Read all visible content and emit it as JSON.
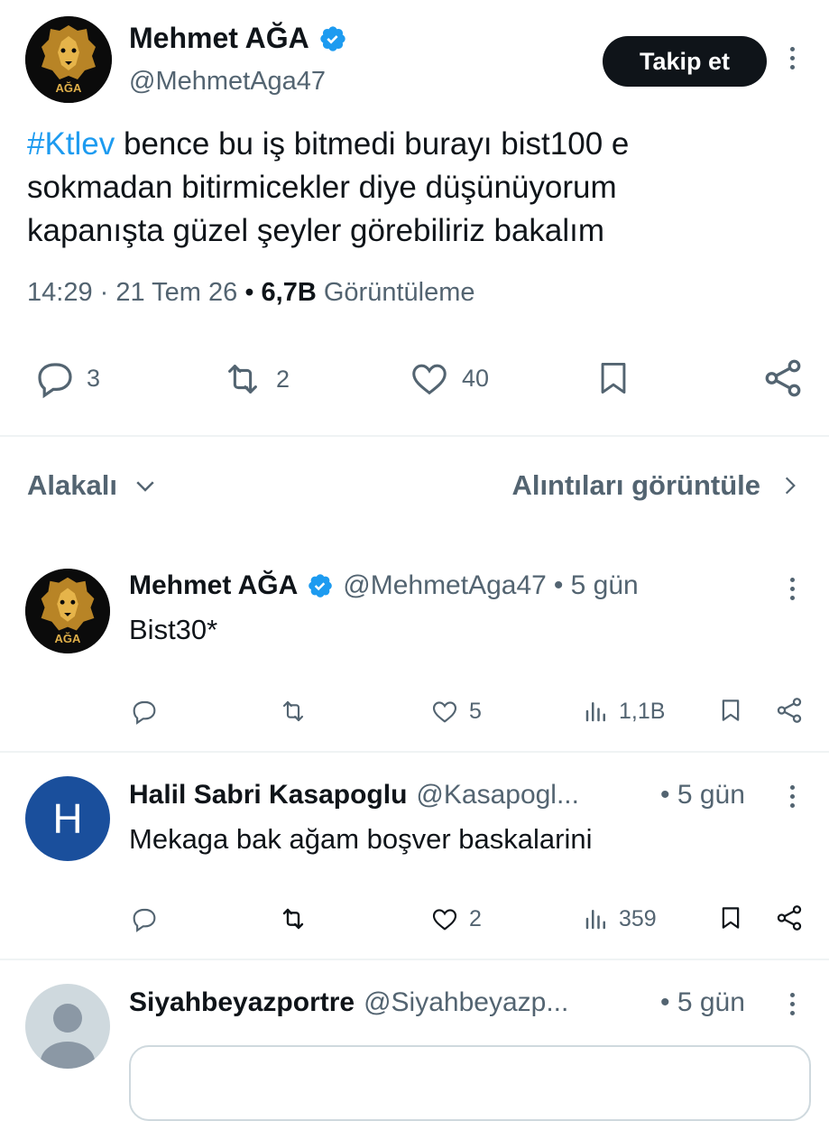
{
  "tweet": {
    "author_name": "Mehmet AĞA",
    "author_handle": "@MehmetAga47",
    "avatar_text": "AĞA",
    "follow_label": "Takip et",
    "hashtag": "#Ktlev",
    "text_line1_rest": " bence bu iş bitmedi burayı bist100 e",
    "text_line2": "sokmadan bitirmicekler diye düşünüyorum",
    "text_line3": "kapanışta güzel şeyler görebiliriz bakalım",
    "time": "14:29",
    "date": "21 Tem 26",
    "views_count": "6,7B",
    "views_label": "Görüntüleme",
    "replies": "3",
    "reposts": "2",
    "likes": "40"
  },
  "sort_bar": {
    "relevance_label": "Alakalı",
    "quotes_label": "Alıntıları görüntüle"
  },
  "replies": [
    {
      "name": "Mehmet AĞA",
      "handle": "@MehmetAga47",
      "time": "• 5 gün",
      "text": "Bist30*",
      "avatar_text": "AĞA",
      "likes": "5",
      "views": "1,1B"
    },
    {
      "name": "Halil Sabri Kasapoglu",
      "handle": "@Kasapogl...",
      "time": "• 5 gün",
      "text": "Mekaga bak ağam boşver baskalarini",
      "avatar_letter": "H",
      "likes": "2",
      "views": "359"
    },
    {
      "name": "Siyahbeyazportre",
      "handle": "@Siyahbeyazp...",
      "time": "• 5 gün"
    }
  ],
  "colors": {
    "accent": "#1d9bf0",
    "text": "#0f1419",
    "secondary": "#536471",
    "verified": "#1d9bf0",
    "lion_gold": "#c8962e"
  }
}
